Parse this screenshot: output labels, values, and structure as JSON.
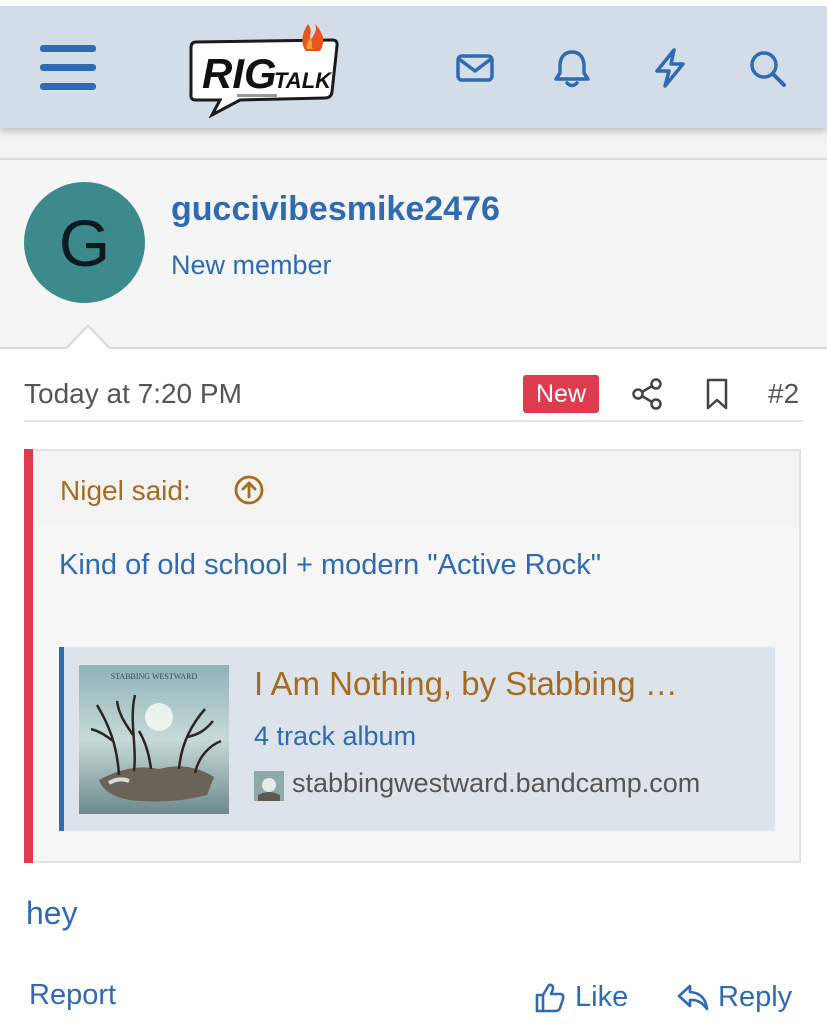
{
  "header": {
    "menu_icon": "hamburger-icon",
    "logo_text_main": "RIG",
    "logo_text_sub": "TALK",
    "icons": [
      "mail-icon",
      "bell-icon",
      "lightning-icon",
      "search-icon"
    ]
  },
  "post": {
    "author": {
      "avatar_letter": "G",
      "username": "guccivibesmike2476",
      "title": "New member"
    },
    "date": "Today at 7:20 PM",
    "badge": "New",
    "number": "#2",
    "quote": {
      "author_label": "Nigel said:",
      "text": "Kind of old school + modern \"Active Rock\"",
      "embed": {
        "title": "I Am Nothing, by Stabbing …",
        "description": "4 track album",
        "site": "stabbingwestward.bandcamp.com",
        "art_lettering": "STABBING WESTWARD"
      }
    },
    "body": "hey",
    "actions": {
      "report": "Report",
      "like": "Like",
      "reply": "Reply"
    }
  },
  "colors": {
    "header_bg": "#d3dde8",
    "link_blue": "#2f6bb2",
    "quote_accent": "#df3b4e",
    "badge_red": "#df3b4e",
    "quote_author": "#a56c1f",
    "avatar_bg": "#3d8a8c"
  }
}
